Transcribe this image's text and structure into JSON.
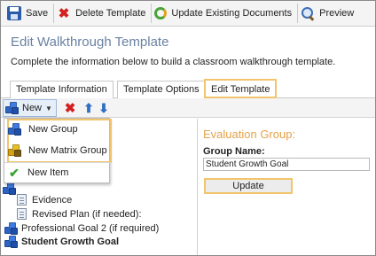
{
  "toolbar": {
    "save_label": "Save",
    "delete_label": "Delete Template",
    "update_docs_label": "Update Existing Documents",
    "preview_label": "Preview"
  },
  "header": {
    "title": "Edit Walkthrough Template",
    "subtitle": "Complete the information below to build a classroom walkthrough template."
  },
  "tabs": [
    {
      "label": "Template Information"
    },
    {
      "label": "Template Options"
    },
    {
      "label": "Edit Template",
      "active": true
    }
  ],
  "tree_toolbar": {
    "new_label": "New"
  },
  "new_menu": {
    "items": [
      {
        "label": "New Group",
        "icon": "group-icon"
      },
      {
        "label": "New Matrix Group",
        "icon": "matrix-group-icon"
      },
      {
        "label": "New Item",
        "icon": "checkmark-icon"
      }
    ]
  },
  "tree": {
    "items": [
      {
        "label": "Evidence",
        "icon": "document-icon"
      },
      {
        "label": "Revised Plan (if needed):",
        "icon": "document-icon"
      },
      {
        "label": "Professional Goal 2 (if required)",
        "icon": "group-icon"
      },
      {
        "label": "Student Growth Goal",
        "icon": "group-icon",
        "selected": true
      }
    ]
  },
  "form": {
    "section_title": "Evaluation Group:",
    "group_name_label": "Group Name:",
    "group_name_value": "Student Growth Goal",
    "update_label": "Update"
  },
  "colors": {
    "highlight": "#f2c46b",
    "section_title": "#e4a24a",
    "page_title": "#6a82a3"
  }
}
